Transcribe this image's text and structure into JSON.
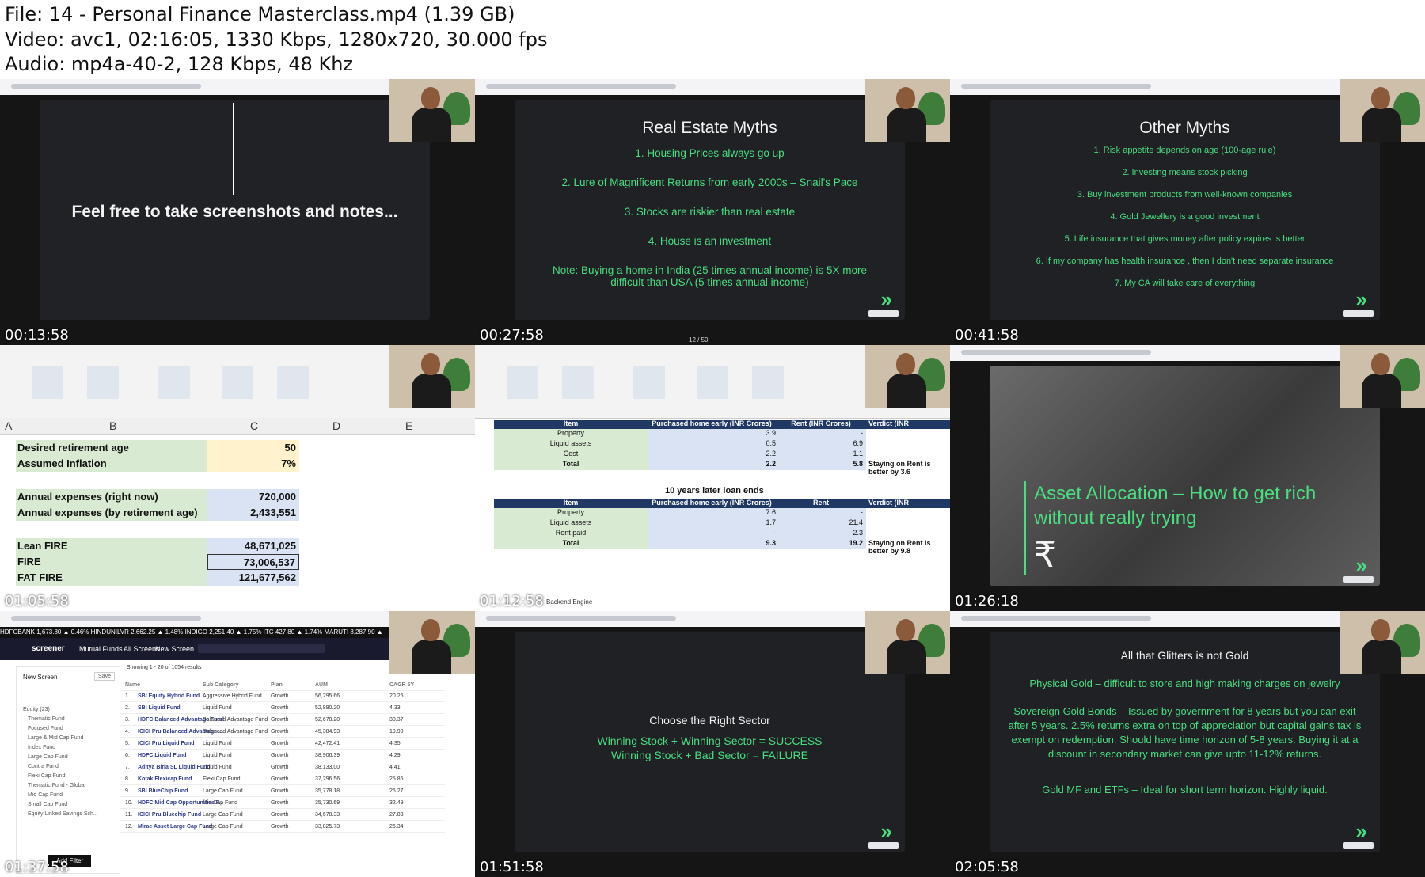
{
  "header": {
    "file": "File: 14 - Personal Finance Masterclass.mp4 (1.39 GB)",
    "video": "Video: avc1, 02:16:05, 1330 Kbps, 1280x720, 30.000 fps",
    "audio": "Audio: mp4a-40-2, 128 Kbps, 48 Khz"
  },
  "thumbs": [
    {
      "timestamp": "00:13:58",
      "text": "Feel free to take screenshots and notes..."
    },
    {
      "timestamp": "00:27:58",
      "title": "Real Estate Myths",
      "items": [
        "1. Housing Prices always go up",
        "2. Lure of Magnificent Returns from early 2000s – Snail's Pace",
        "3. Stocks are riskier than real estate",
        "4. House is an investment",
        "Note: Buying a home in India (25 times annual income) is 5X more difficult than USA (5 times annual income)"
      ],
      "pager": "12 / 50"
    },
    {
      "timestamp": "00:41:58",
      "title": "Other Myths",
      "items": [
        "1. Risk appetite depends on age (100-age rule)",
        "2. Investing means stock picking",
        "3. Buy investment products from well-known companies",
        "4. Gold Jewellery is a good investment",
        "5. Life insurance that gives money after policy expires is better",
        "6. If my company has health insurance , then I don't need separate insurance",
        "7. My CA will take care of everything"
      ]
    },
    {
      "timestamp": "01:05:58",
      "columns": [
        "A",
        "B",
        "C",
        "D",
        "E"
      ],
      "rows": [
        {
          "label": "Desired retirement age",
          "value": "50"
        },
        {
          "label": "Assumed Inflation",
          "value": "7%"
        },
        {
          "label": "Annual expenses (right now)",
          "value": "720,000"
        },
        {
          "label": "Annual expenses (by retirement age)",
          "value": "2,433,551"
        },
        {
          "label": "Lean FIRE",
          "value": "48,671,025"
        },
        {
          "label": "FIRE",
          "value": "73,006,537"
        },
        {
          "label": "FAT FIRE",
          "value": "121,677,562"
        }
      ]
    },
    {
      "timestamp": "01:12:58",
      "table1": {
        "headers": [
          "Item",
          "Purchased home early (INR Crores)",
          "Rent (INR Crores)",
          "Verdict (INR"
        ],
        "rows": [
          [
            "Property",
            "3.9",
            "-",
            ""
          ],
          [
            "Liquid assets",
            "0.5",
            "6.9",
            ""
          ],
          [
            "Cost",
            "-2.2",
            "-1.1",
            ""
          ],
          [
            "Total",
            "2.2",
            "5.8",
            "Staying on Rent is better by 3.6"
          ]
        ]
      },
      "table2_title": "10 years later loan ends",
      "table2": {
        "headers": [
          "Item",
          "Purchased home early (INR Crores)",
          "Rent",
          "Verdict (INR"
        ],
        "rows": [
          [
            "Property",
            "7.6",
            "-",
            ""
          ],
          [
            "Liquid assets",
            "1.7",
            "21.4",
            ""
          ],
          [
            "Rent paid",
            "-",
            "-2.3",
            ""
          ],
          [
            "Total",
            "9.3",
            "19.2",
            "Staying on Rent is better by 9.8"
          ]
        ]
      },
      "sheet_tab": "Backend Engine"
    },
    {
      "timestamp": "01:26:18",
      "title": "Asset Allocation – How to get rich without really trying",
      "symbol": "₹"
    },
    {
      "timestamp": "01:37:58",
      "ticker": "HDFCBANK 1,673.80 ▲ 0.46%   HINDUNILVR 2,662.25 ▲ 1.48%   INDIGO 2,251.40 ▲ 1.75%   ITC 427.80 ▲ 1.74%   MARUTI 8,287.90 ▲",
      "brand": "screener",
      "nav": [
        "Mutual Funds",
        "All Screens",
        "New Screen"
      ],
      "screen_title": "New Screen",
      "save": "Save",
      "showing": "Showing 1 - 20 of 1054 results",
      "filters": [
        "Equity (23)",
        "Thematic Fund",
        "Focused Fund",
        "Large & Mid Cap Fund",
        "Index Fund",
        "Large Cap Fund",
        "Contra Fund",
        "Flexi Cap Fund",
        "Thematic Fund - Global",
        "Mid Cap Fund",
        "Small Cap Fund",
        "Equity Linked Savings Sch..."
      ],
      "add_filter": "Add Filter",
      "table_headers": [
        "Name",
        "Sub Category",
        "Plan",
        "AUM",
        "CAGR 5Y"
      ],
      "funds": [
        [
          "1.",
          "SBI Equity Hybrid Fund",
          "Aggressive Hybrid Fund",
          "Growth",
          "56,295.66",
          "20.25"
        ],
        [
          "2.",
          "SBI Liquid Fund",
          "Liquid Fund",
          "Growth",
          "52,890.20",
          "4.33"
        ],
        [
          "3.",
          "HDFC Balanced Advantage Fund",
          "Balanced Advantage Fund",
          "Growth",
          "52,678.20",
          "30.37"
        ],
        [
          "4.",
          "ICICI Pru Balanced Advantage ...",
          "Balanced Advantage Fund",
          "Growth",
          "45,384.93",
          "19.90"
        ],
        [
          "5.",
          "ICICI Pru Liquid Fund",
          "Liquid Fund",
          "Growth",
          "42,472.41",
          "4.35"
        ],
        [
          "6.",
          "HDFC Liquid Fund",
          "Liquid Fund",
          "Growth",
          "38,906.39",
          "4.29"
        ],
        [
          "7.",
          "Aditya Birla SL Liquid Fund",
          "Liquid Fund",
          "Growth",
          "38,133.00",
          "4.41"
        ],
        [
          "8.",
          "Kotak Flexicap Fund",
          "Flexi Cap Fund",
          "Growth",
          "37,296.56",
          "25.85"
        ],
        [
          "9.",
          "SBI BlueChip Fund",
          "Large Cap Fund",
          "Growth",
          "35,778.18",
          "26.27"
        ],
        [
          "10.",
          "HDFC Mid-Cap Opportunities F...",
          "Mid Cap Fund",
          "Growth",
          "35,730.69",
          "32.49"
        ],
        [
          "11.",
          "ICICI Pru Bluechip Fund",
          "Large Cap Fund",
          "Growth",
          "34,678.33",
          "27.83"
        ],
        [
          "12.",
          "Mirae Asset Large Cap Fund",
          "Large Cap Fund",
          "Growth",
          "33,825.73",
          "26.34"
        ]
      ]
    },
    {
      "timestamp": "01:51:58",
      "title": "Choose the Right Sector",
      "items": [
        "Winning Stock + Winning Sector = SUCCESS",
        "Winning Stock + Bad Sector = FAILURE"
      ]
    },
    {
      "timestamp": "02:05:58",
      "title": "All that Glitters is not Gold",
      "items": [
        "Physical Gold – difficult to store and high making charges on jewelry",
        "Sovereign Gold Bonds – Issued by government for 8 years but you can exit after 5 years. 2.5% returns extra on top of appreciation but capital gains tax is exempt on redemption. Should have time horizon of 5-8 years. Buying it at a discount in secondary market can give upto 11-12% returns.",
        "Gold MF and ETFs – Ideal for short term horizon. Highly liquid."
      ]
    }
  ],
  "colors": {
    "slide_bg": "#1f2124",
    "accent_green": "#4ade80",
    "sheet_green": "#d9ead3",
    "sheet_blue": "#dae3f3",
    "table_header": "#1f3864"
  }
}
